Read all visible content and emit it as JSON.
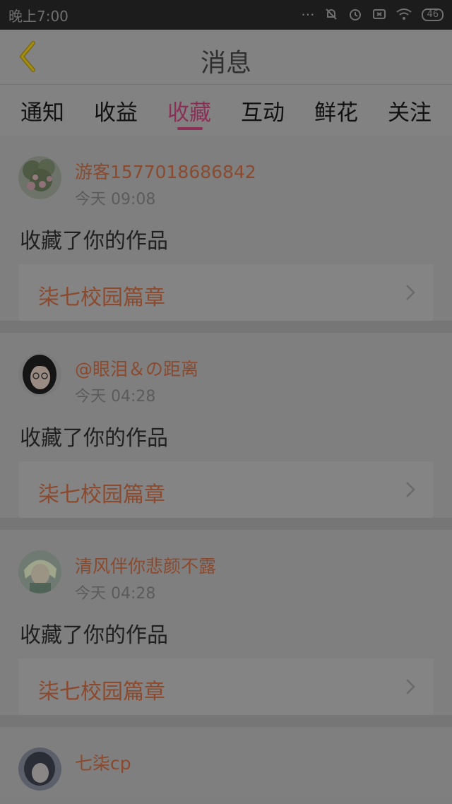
{
  "status_bar": {
    "time": "晚上7:00",
    "icons": [
      "dots-icon",
      "mute-icon",
      "alarm-icon",
      "sim-icon",
      "wifi-icon"
    ],
    "battery": "46"
  },
  "header": {
    "title": "消息"
  },
  "tabs": [
    {
      "label": "通知",
      "active": false
    },
    {
      "label": "收益",
      "active": false
    },
    {
      "label": "收藏",
      "active": true
    },
    {
      "label": "互动",
      "active": false
    },
    {
      "label": "鲜花",
      "active": false
    },
    {
      "label": "关注",
      "active": false
    }
  ],
  "messages": [
    {
      "username": "游客1577018686842",
      "time": "今天 09:08",
      "action": "收藏了你的作品",
      "work_title": "柒七校园篇章"
    },
    {
      "username": "@眼泪＆の距离",
      "time": "今天 04:28",
      "action": "收藏了你的作品",
      "work_title": "柒七校园篇章"
    },
    {
      "username": "清风伴你悲颜不露",
      "time": "今天 04:28",
      "action": "收藏了你的作品",
      "work_title": "柒七校园篇章"
    },
    {
      "username": "七柒cp"
    }
  ],
  "colors": {
    "accent": "#8c2f57",
    "username": "#8b4a2e",
    "overlay_bg": "#7e7e7e"
  }
}
